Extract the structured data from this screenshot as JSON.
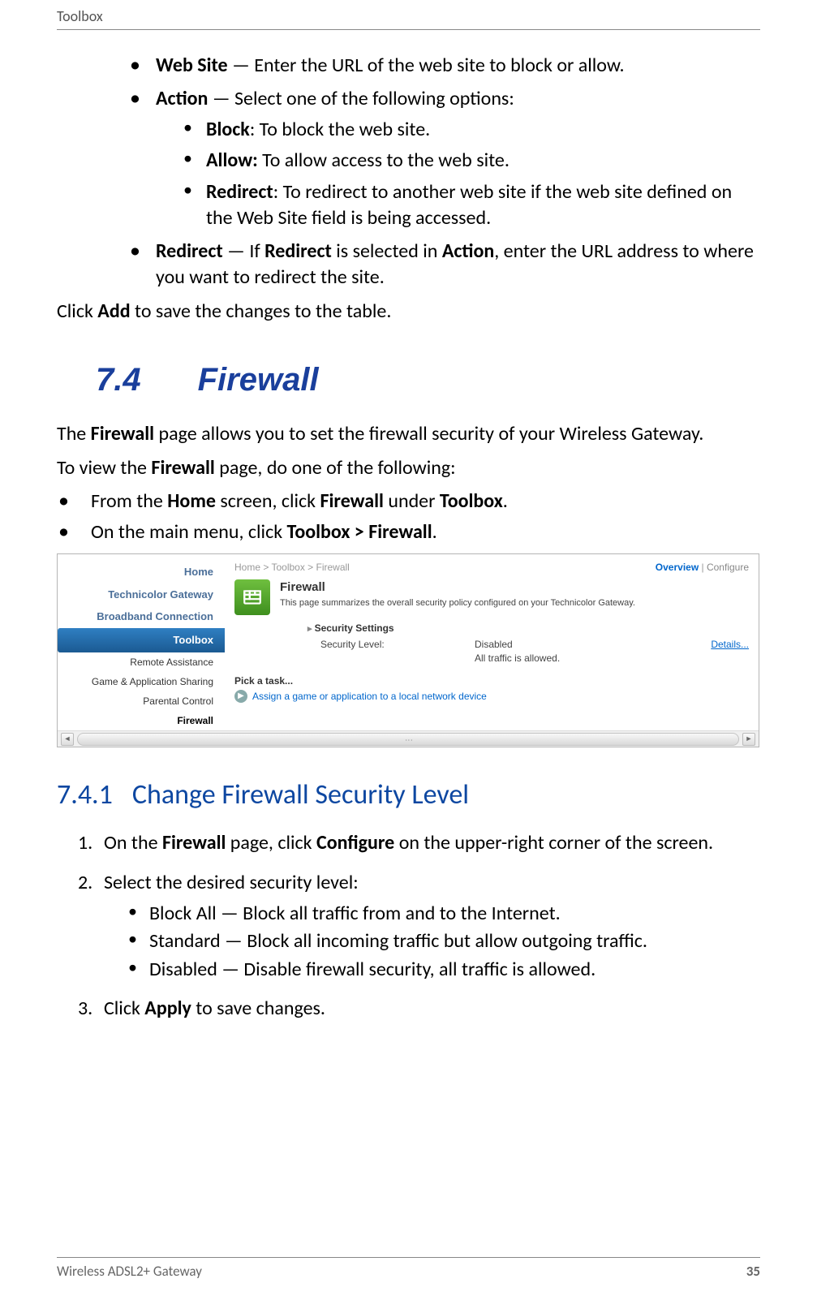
{
  "header": {
    "title": "Toolbox"
  },
  "topList": {
    "webSite": {
      "label": "Web Site",
      "text": " — Enter the URL of the web site to block or allow."
    },
    "action": {
      "label": "Action",
      "text": " — Select one of the following options:"
    },
    "actionOpts": {
      "block": {
        "label": "Block",
        "sep": ": ",
        "text": "To block the web site."
      },
      "allow": {
        "label": "Allow:",
        "sep": " ",
        "text": "To allow access to the web site."
      },
      "redirect": {
        "label": "Redirect",
        "sep": ": ",
        "text": "To redirect to another web site if the web site defined on the Web Site field is being accessed."
      }
    },
    "redirect": {
      "label": "Redirect",
      "pre": " — If ",
      "b2": "Redirect",
      "mid": " is selected in ",
      "b3": "Action",
      "post": ", enter the URL address to where you want to redirect the site."
    }
  },
  "clickAdd": {
    "pre": "Click ",
    "b": "Add",
    "post": " to save the changes to the table."
  },
  "secHead": {
    "num": "7.4",
    "title": "Firewall"
  },
  "fwIntro": {
    "pre": "The ",
    "b": "Firewall",
    "post": " page allows you to set the firewall security of your Wireless Gateway."
  },
  "fwView": {
    "pre": "To view the ",
    "b": "Firewall",
    "post": " page, do one of the following:"
  },
  "viewBullets": {
    "home": {
      "pre": "From the ",
      "b1": "Home",
      "mid": " screen, click ",
      "b2": "Firewall",
      "mid2": " under ",
      "b3": "Toolbox",
      "post": "."
    },
    "menu": {
      "pre": "On the main menu, click ",
      "b1": "Toolbox > Firewall",
      "post": "."
    }
  },
  "screenshot": {
    "sidebar": {
      "home": "Home",
      "gateway": "Technicolor Gateway",
      "broadband": "Broadband Connection",
      "toolbox": "Toolbox",
      "subs": {
        "remote": "Remote Assistance",
        "game": "Game & Application Sharing",
        "parental": "Parental Control",
        "firewall": "Firewall"
      }
    },
    "breadcrumb": "Home > Toolbox > Firewall",
    "overview": "Overview",
    "configure": "Configure",
    "fwTitle": "Firewall",
    "fwDesc": "This page summarizes the overall security policy configured on your Technicolor Gateway.",
    "setTitle": "Security Settings",
    "setLabel": "Security Level:",
    "setVal": "Disabled",
    "setVal2": "All traffic is allowed.",
    "details": "Details...",
    "pickTitle": "Pick a task...",
    "pickLink": "Assign a game or application to a local network device"
  },
  "sub": {
    "num": "7.4.1",
    "title": "Change Firewall Security Level"
  },
  "steps": {
    "s1": {
      "pre": "On the ",
      "b1": "Firewall",
      "mid": " page, click ",
      "b2": "Configure",
      "post": " on the upper-right corner of the screen."
    },
    "s2": {
      "text": "Select the desired security level:",
      "opts": {
        "a": "Block All — Block all traffic from and to the Internet.",
        "b": "Standard — Block all incoming traffic but allow outgoing traffic.",
        "c": "Disabled — Disable firewall security, all traffic is allowed."
      }
    },
    "s3": {
      "pre": "Click ",
      "b": "Apply",
      "post": " to save changes."
    }
  },
  "footer": {
    "left": "Wireless ADSL2+ Gateway",
    "page": "35"
  }
}
